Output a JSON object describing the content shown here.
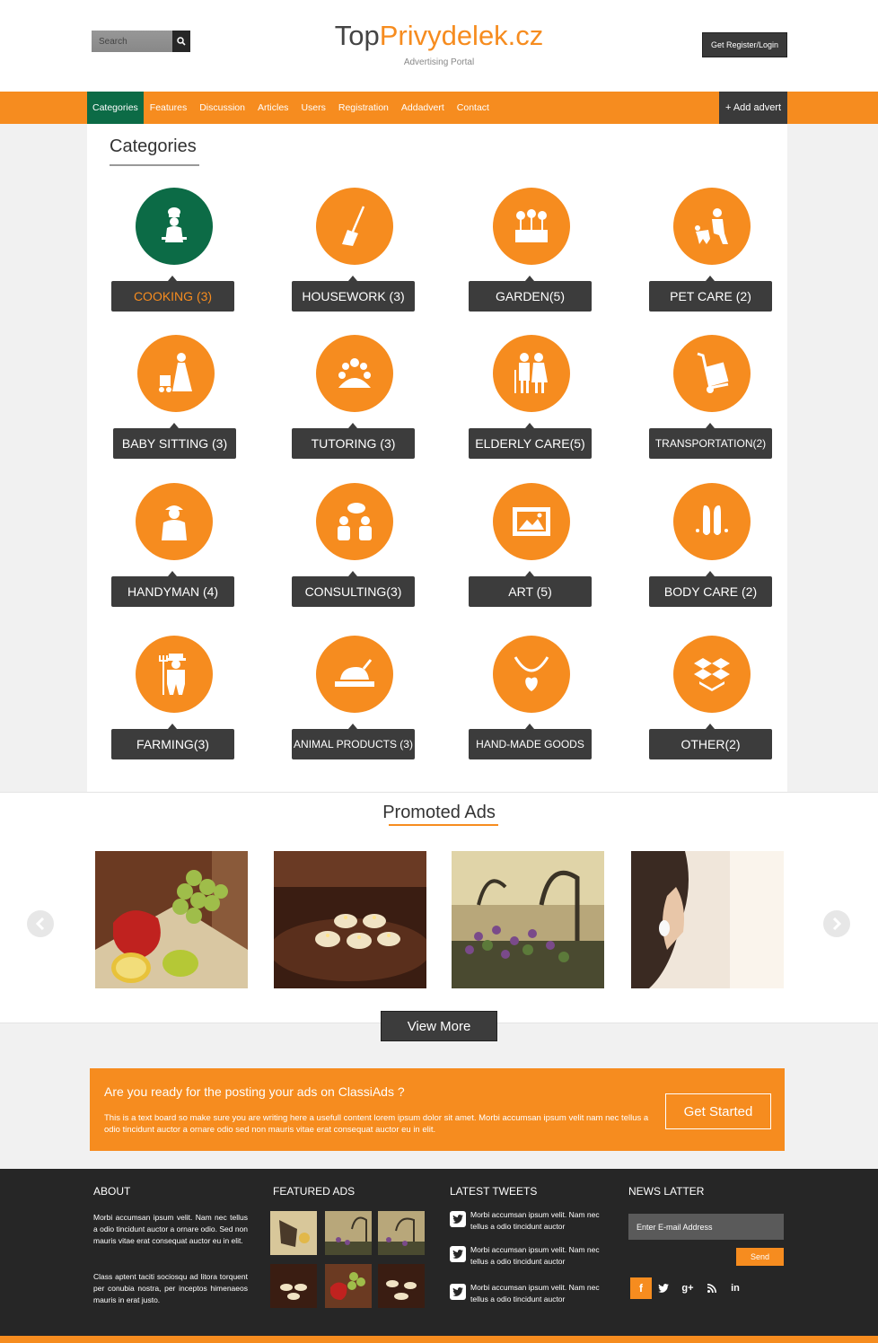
{
  "header": {
    "search_placeholder": "Search",
    "logo_part1": "Top",
    "logo_part2": "Privydelek.cz",
    "tagline": "Advertising Portal",
    "register_label": "Get Register/Login"
  },
  "nav": {
    "items": [
      "Categories",
      "Features",
      "Discussion",
      "Articles",
      "Users",
      "Registration",
      "Addadvert",
      "Contact"
    ],
    "active": "Categories",
    "add_label": "+ Add advert"
  },
  "categories": {
    "title": "Categories",
    "items": [
      {
        "label": "COOKING (3)",
        "icon": "chef-icon"
      },
      {
        "label": "HOUSEWORK (3)",
        "icon": "broom-icon"
      },
      {
        "label": "GARDEN(5)",
        "icon": "flower-pot-icon"
      },
      {
        "label": "PET CARE  (2)",
        "icon": "pet-icon"
      },
      {
        "label": "BABY SITTING  (3)",
        "icon": "stroller-icon"
      },
      {
        "label": "TUTORING (3)",
        "icon": "group-icon"
      },
      {
        "label": "ELDERLY CARE(5)",
        "icon": "elderly-icon"
      },
      {
        "label": "TRANSPORTATION(2)",
        "icon": "hand-truck-icon"
      },
      {
        "label": "HANDYMAN (4)",
        "icon": "worker-icon"
      },
      {
        "label": "CONSULTING(3)",
        "icon": "consulting-icon"
      },
      {
        "label": "ART (5)",
        "icon": "picture-icon"
      },
      {
        "label": "BODY CARE (2)",
        "icon": "feet-icon"
      },
      {
        "label": "FARMING(3)",
        "icon": "farmer-icon"
      },
      {
        "label": "ANIMAL PRODUCTS (3)",
        "icon": "roast-chicken-icon"
      },
      {
        "label": "HAND-MADE GOODS",
        "icon": "necklace-icon"
      },
      {
        "label": "OTHER(2)",
        "icon": "box-icon"
      }
    ]
  },
  "promoted": {
    "title": "Promoted Ads",
    "images": [
      "vegetables-photo",
      "candles-photo",
      "flowers-photo",
      "woman-photo"
    ],
    "view_more": "View More"
  },
  "cta": {
    "title": "Are you ready for the posting your ads on ClassiAds ?",
    "text": "This is a text board so make sure you are writing here a usefull content lorem ipsum dolor sit amet. Morbi accumsan ipsum velit nam nec tellus a odio tincidunt auctor a ornare odio sed non mauris vitae erat consequat auctor eu in elit.",
    "button": "Get Started"
  },
  "footer": {
    "about_title": "ABOUT",
    "about_p1": "Morbi accumsan ipsum velit. Nam nec tellus a odio tincidunt auctor a ornare odio. Sed non mauris vitae erat consequat auctor eu in elit.",
    "about_p2": "Class aptent taciti sociosqu ad litora torquent per conubia nostra, per inceptos himenaeos mauris in erat justo.",
    "featured_title": "FEATURED ADS",
    "tweets_title": "LATEST TWEETS",
    "tweets": [
      "Morbi accumsan ipsum velit. Nam nec tellus a odio tincidunt auctor",
      "Morbi accumsan ipsum velit. Nam nec tellus a odio tincidunt auctor",
      "Morbi accumsan ipsum velit. Nam nec tellus a odio tincidunt auctor"
    ],
    "newsletter_title": "NEWS LATTER",
    "email_placeholder": "Enter E-mail Address",
    "send_label": "Send"
  },
  "colors": {
    "accent": "#f68c1f",
    "active_green": "#0c6b46",
    "dark": "#3c3c3c",
    "footer": "#262626"
  }
}
